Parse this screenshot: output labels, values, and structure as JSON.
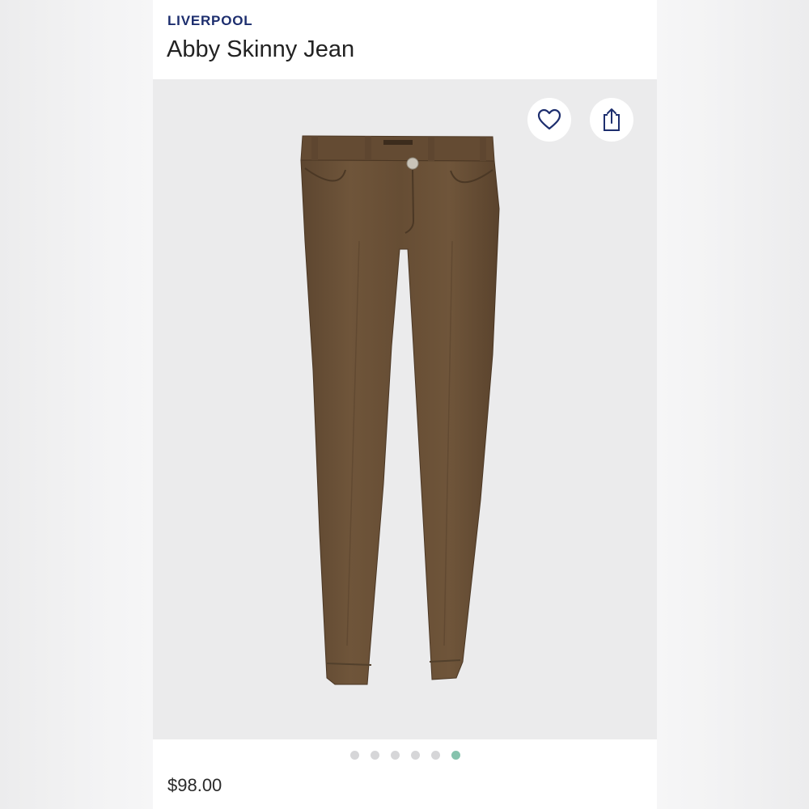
{
  "header": {
    "brand": "LIVERPOOL",
    "title": "Abby Skinny Jean"
  },
  "gallery": {
    "icons": {
      "favorite": "heart-icon",
      "share": "share-icon"
    },
    "image_description_icon": "jeans-photo",
    "pagination": {
      "total": 6,
      "active_index": 5
    },
    "colors": {
      "background": "#ebebec",
      "jean": "#6e5438",
      "active_dot": "#86c3ad",
      "inactive_dot": "#d6d6d8"
    }
  },
  "product": {
    "price": "$98.00"
  },
  "colors": {
    "brand": "#1d2e6e",
    "text": "#222222"
  }
}
